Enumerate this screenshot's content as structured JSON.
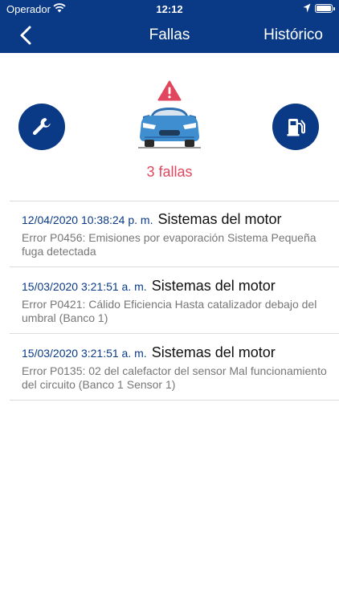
{
  "status_bar": {
    "carrier": "Operador",
    "time": "12:12"
  },
  "nav": {
    "title": "Fallas",
    "history_label": "Histórico"
  },
  "summary": {
    "fault_count_text": "3 fallas"
  },
  "faults": [
    {
      "date": "12/04/2020 10:38:24 p. m.",
      "system": "Sistemas del motor",
      "description": "Error P0456: Emisiones por evaporación Sistema Pequeña fuga detectada"
    },
    {
      "date": "15/03/2020 3:21:51 a. m.",
      "system": "Sistemas del motor",
      "description": "Error P0421: Cálido Eficiencia Hasta catalizador debajo del umbral (Banco 1)"
    },
    {
      "date": "15/03/2020 3:21:51 a. m.",
      "system": "Sistemas del motor",
      "description": "Error P0135: 02 del calefactor del sensor Mal funcionamiento del circuito (Banco 1 Sensor 1)"
    }
  ],
  "colors": {
    "primary": "#0a3a86",
    "alert": "#e0475e",
    "car": "#3f8fd0"
  },
  "icons": [
    "wifi-icon",
    "location-arrow-icon",
    "battery-icon",
    "back-chevron-icon",
    "wrench-icon",
    "warning-icon",
    "car-icon",
    "fuel-pump-icon"
  ]
}
